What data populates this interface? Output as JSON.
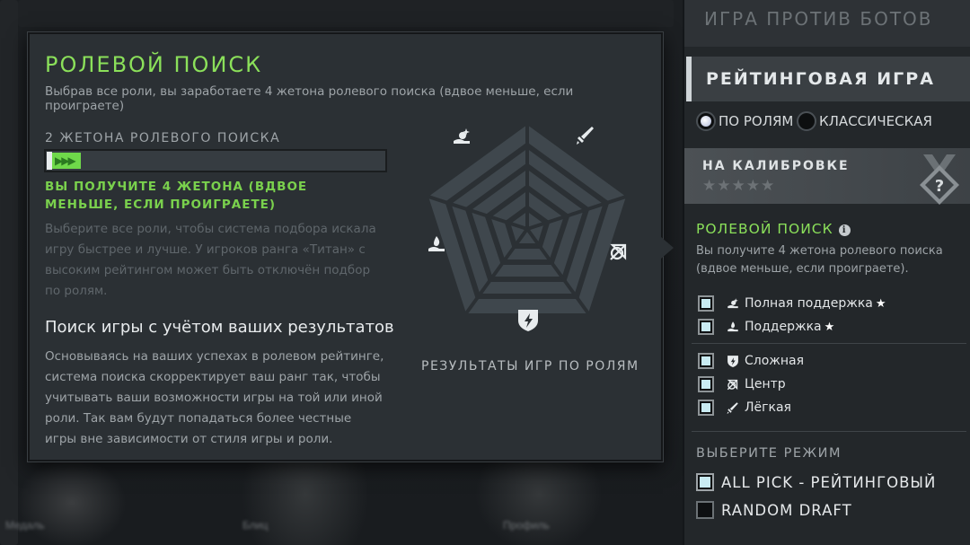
{
  "background": {
    "captions": [
      "Медаль",
      "Блиц",
      "Профиль"
    ]
  },
  "popup": {
    "title": "РОЛЕВОЙ ПОИСК",
    "subtitle": "Выбрав все роли, вы заработаете 4 жетона ролевого поиска (вдвое меньше, если проиграете)",
    "tokens_label": "2 ЖЕТОНА РОЛЕВОГО ПОИСКА",
    "token_progress_fraction": 0.1,
    "token_arrows": "▶▶▶",
    "tokens_earn": "ВЫ ПОЛУЧИТЕ 4 ЖЕТОНА (ВДВОЕ МЕНЬШЕ, ЕСЛИ ПРОИГРАЕТЕ)",
    "tokens_desc": "Выберите все роли, чтобы система подбора искала игру быстрее и лучше. У игроков ранга «Титан» с высоким рейтингом может быть отключён подбор по ролям.",
    "section_title": "Поиск игры с учётом ваших результатов",
    "section_desc": "Основываясь на ваших успехах в ролевом рейтинге, система поиска скорректирует ваш ранг так, чтобы учитывать ваши возможности игры на той или иной роли. Так вам будут попадаться более честные игры вне зависимости от стиля игры и роли.",
    "radar_caption": "РЕЗУЛЬТАТЫ ИГР ПО РОЛЯМ",
    "radar_icons": [
      "hard-support-icon",
      "safe-lane-icon",
      "mid-lane-icon",
      "offlane-icon",
      "soft-support-icon"
    ],
    "colors": {
      "accent_green": "#8be05a",
      "panel": "#2b3034"
    }
  },
  "sidebar": {
    "bots_title": "ИГРА ПРОТИВ БОТОВ",
    "ranked_title": "РЕЙТИНГОВАЯ ИГРА",
    "match_types": [
      {
        "label": "ПО РОЛЯМ",
        "selected": true
      },
      {
        "label": "КЛАССИЧЕСКАЯ",
        "selected": false
      }
    ],
    "calibration": {
      "title": "НА КАЛИБРОВКЕ",
      "stars": "★★★★★",
      "medal_symbol": "?"
    },
    "role_search": {
      "title": "РОЛЕВОЙ ПОИСК",
      "info": "i",
      "desc": "Вы получите 4 жетона ролевого поиска (вдвое меньше, если проиграете)."
    },
    "roles": [
      {
        "label": "Полная поддержка",
        "star": "★",
        "icon": "hard-support-icon",
        "checked": true
      },
      {
        "label": "Поддержка",
        "star": "★",
        "icon": "soft-support-icon",
        "checked": true
      },
      {
        "label": "Сложная",
        "star": "",
        "icon": "offlane-icon",
        "checked": true
      },
      {
        "label": "Центр",
        "star": "",
        "icon": "mid-lane-icon",
        "checked": true
      },
      {
        "label": "Лёгкая",
        "star": "",
        "icon": "safe-lane-icon",
        "checked": true
      }
    ],
    "mode_title": "ВЫБЕРИТЕ РЕЖИМ",
    "modes": [
      {
        "label": "ALL PICK - РЕЙТИНГОВЫЙ",
        "checked": true
      },
      {
        "label": "RANDOM DRAFT",
        "checked": false
      }
    ]
  }
}
